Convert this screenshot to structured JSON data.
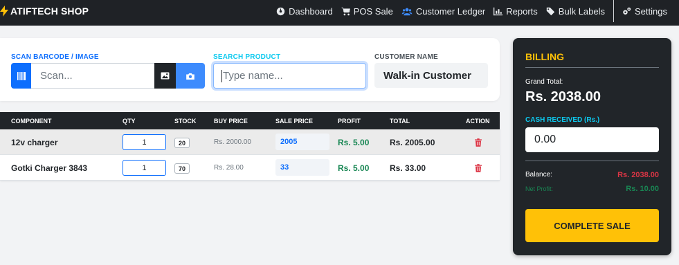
{
  "nav": {
    "brand": "ATIFTECH SHOP",
    "links": {
      "dashboard": "Dashboard",
      "pos_sale": "POS Sale",
      "customer_ledger": "Customer Ledger",
      "reports": "Reports",
      "bulk_labels": "Bulk Labels",
      "settings": "Settings"
    }
  },
  "scan": {
    "label": "SCAN BARCODE / IMAGE",
    "placeholder": "Scan..."
  },
  "search": {
    "label": "SEARCH PRODUCT",
    "placeholder": "Type name..."
  },
  "customer": {
    "label": "CUSTOMER NAME",
    "value": "Walk-in Customer"
  },
  "table": {
    "headers": {
      "component": "COMPONENT",
      "qty": "QTY",
      "stock": "STOCK",
      "buy_price": "BUY PRICE",
      "sale_price": "SALE PRICE",
      "profit": "PROFIT",
      "total": "TOTAL",
      "action": "ACTION"
    },
    "rows": [
      {
        "component": "12v charger",
        "qty": "1",
        "stock": "20",
        "buy_price": "Rs. 2000.00",
        "sale_price": "2005",
        "profit": "Rs. 5.00",
        "total": "Rs. 2005.00"
      },
      {
        "component": "Gotki Charger 3843",
        "qty": "1",
        "stock": "70",
        "buy_price": "Rs. 28.00",
        "sale_price": "33",
        "profit": "Rs. 5.00",
        "total": "Rs. 33.00"
      }
    ]
  },
  "billing": {
    "title": "BILLING",
    "grand_total_label": "Grand Total:",
    "grand_total_value": "Rs. 2038.00",
    "cash_label": "CASH RECEIVED (Rs.)",
    "cash_value": "0.00",
    "balance_label": "Balance:",
    "balance_value": "Rs. 2038.00",
    "net_profit_label": "Net Profit:",
    "net_profit_value": "Rs. 10.00",
    "complete_label": "COMPLETE SALE"
  },
  "colors": {
    "nav_bg": "#1f2226",
    "primary": "#0d6efd",
    "accent_yellow": "#ffc107",
    "success": "#198754",
    "danger": "#dc3545",
    "info": "#0dcaf0"
  }
}
